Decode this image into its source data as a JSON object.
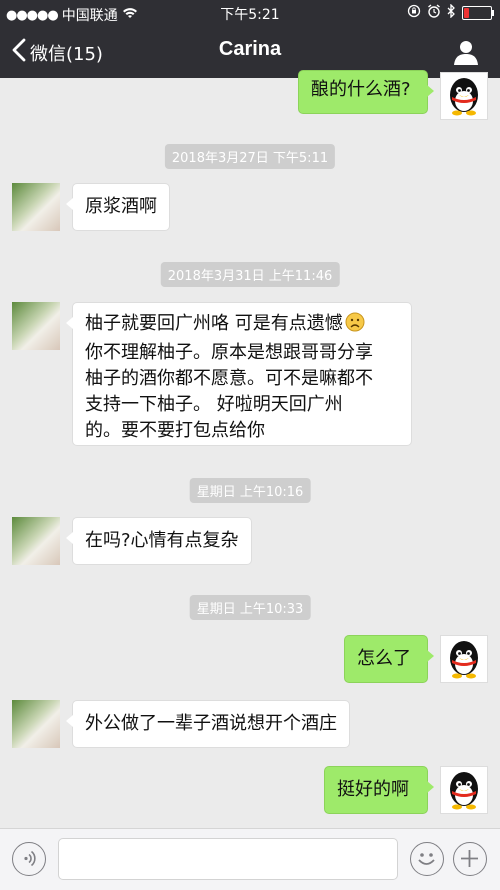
{
  "status_bar": {
    "signal": "●●●●●",
    "carrier": "中国联通",
    "time": "下午5:21"
  },
  "nav": {
    "back_label": "微信(15)",
    "title": "Carina"
  },
  "messages": [
    {
      "type": "out",
      "text": "酿的什么酒?"
    },
    {
      "type": "time",
      "text": "2018年3月27日 下午5:11"
    },
    {
      "type": "in",
      "text": "原浆酒啊"
    },
    {
      "type": "time",
      "text": "2018年3月31日 上午11:46"
    },
    {
      "type": "in",
      "lines": [
        "柚子就要回广州咯 可是有点遗憾",
        "你不理解柚子。原本是想跟哥哥分享",
        "柚子的酒你都不愿意。可不是嘛都不",
        "支持一下柚子。 好啦明天回广州",
        "的。要不要打包点给你"
      ],
      "emoji": "sad-face-emoji"
    },
    {
      "type": "time",
      "text": "星期日 上午10:16"
    },
    {
      "type": "in",
      "text": "在吗?心情有点复杂"
    },
    {
      "type": "time",
      "text": "星期日 上午10:33"
    },
    {
      "type": "out",
      "text": "怎么了"
    },
    {
      "type": "in",
      "text": "外公做了一辈子酒说想开个酒庄"
    },
    {
      "type": "out",
      "text": "挺好的啊"
    }
  ],
  "colors": {
    "bar": "#2f2f34",
    "background": "#ebebeb",
    "out_bubble": "#9eea6a",
    "in_bubble": "#ffffff",
    "time_badge": "#cecece"
  },
  "icons": [
    "wifi-icon",
    "lock-rotation-icon",
    "alarm-icon",
    "bluetooth-icon",
    "battery-icon",
    "back-chevron-icon",
    "profile-icon",
    "voice-icon",
    "emoji-icon",
    "plus-icon",
    "penguin-avatar-icon"
  ]
}
